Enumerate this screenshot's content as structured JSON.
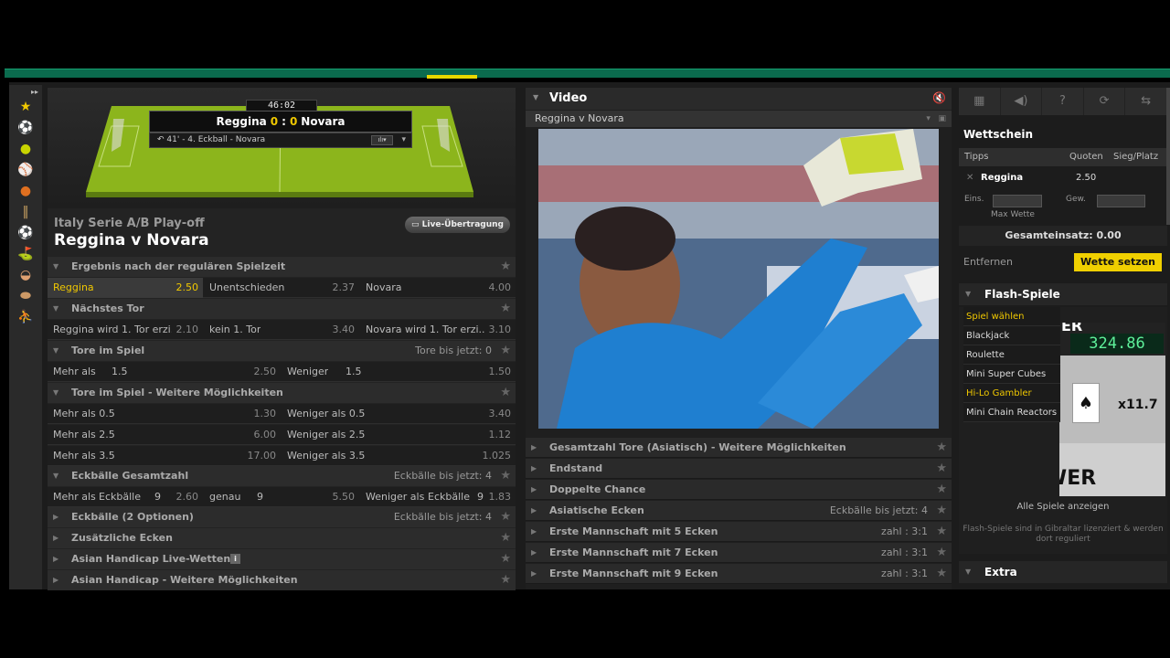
{
  "scoreboard": {
    "time": "46:02",
    "home": "Reggina",
    "home_score": "0",
    "sep": ":",
    "away_score": "0",
    "away": "Novara",
    "event": "41' - 4. Eckball - Novara"
  },
  "match": {
    "league": "Italy Serie A/B Play-off",
    "title": "Reggina v Novara",
    "live_button": "Live-Übertragung"
  },
  "markets": {
    "result": {
      "header": "Ergebnis nach der regulären Spielzeit",
      "home": "Reggina",
      "home_odds": "2.50",
      "draw": "Unentschieden",
      "draw_odds": "2.37",
      "away": "Novara",
      "away_odds": "4.00"
    },
    "next_goal": {
      "header": "Nächstes Tor",
      "a": "Reggina wird 1. Tor erzi...",
      "a_odds": "2.10",
      "b": "kein 1. Tor",
      "b_odds": "3.40",
      "c": "Novara wird 1. Tor erzi...",
      "c_odds": "3.10"
    },
    "goals": {
      "header": "Tore im Spiel",
      "note": "Tore bis jetzt: 0",
      "over": "Mehr als",
      "over_line": "1.5",
      "over_odds": "2.50",
      "under": "Weniger",
      "under_line": "1.5",
      "under_odds": "1.50"
    },
    "goals_more": {
      "header": "Tore im Spiel - Weitere Möglichkeiten",
      "rows": [
        {
          "over": "Mehr als 0.5",
          "over_odds": "1.30",
          "under": "Weniger als 0.5",
          "under_odds": "3.40"
        },
        {
          "over": "Mehr als 2.5",
          "over_odds": "6.00",
          "under": "Weniger als 2.5",
          "under_odds": "1.12"
        },
        {
          "over": "Mehr als 3.5",
          "over_odds": "17.00",
          "under": "Weniger als 3.5",
          "under_odds": "1.025"
        }
      ]
    },
    "corners": {
      "header": "Eckbälle Gesamtzahl",
      "note": "Eckbälle bis jetzt: 4",
      "a": "Mehr als",
      "a_unit": "Eckbälle",
      "a_line": "9",
      "a_odds": "2.60",
      "b": "genau",
      "b_line": "9",
      "b_odds": "5.50",
      "c": "Weniger als",
      "c_unit": "Eckbälle",
      "c_line": "9",
      "c_odds": "1.83"
    },
    "collapsed": [
      {
        "label": "Eckbälle (2 Optionen)",
        "note": "Eckbälle bis jetzt: 4"
      },
      {
        "label": "Zusätzliche Ecken",
        "note": ""
      },
      {
        "label": "Asian Handicap Live-Wetten",
        "note": ""
      },
      {
        "label": "Asian Handicap - Weitere Möglichkeiten",
        "note": ""
      }
    ]
  },
  "video": {
    "title": "Video",
    "subtitle": "Reggina v Novara",
    "markets": [
      {
        "label": "Gesamtzahl Tore (Asiatisch) - Weitere Möglichkeiten",
        "note": ""
      },
      {
        "label": "Endstand",
        "note": ""
      },
      {
        "label": "Doppelte Chance",
        "note": ""
      },
      {
        "label": "Asiatische Ecken",
        "note": "Eckbälle bis jetzt: 4"
      },
      {
        "label": "Erste Mannschaft mit 5 Ecken",
        "note": "zahl : 3:1"
      },
      {
        "label": "Erste Mannschaft mit 7 Ecken",
        "note": "zahl : 3:1"
      },
      {
        "label": "Erste Mannschaft mit 9 Ecken",
        "note": "zahl : 3:1"
      }
    ]
  },
  "betslip": {
    "title": "Wettschein",
    "col_tips": "Tipps",
    "col_odds": "Quoten",
    "col_ew": "Sieg/Platz",
    "selection": "Reggina",
    "selection_odds": "2.50",
    "stake_label": "Eins.",
    "win_label": "Gew.",
    "max_bet": "Max Wette",
    "total": "Gesamteinsatz: 0.00",
    "remove": "Entfernen",
    "place": "Wette setzen"
  },
  "flash": {
    "title": "Flash-Spiele",
    "menu": [
      "Spiel wählen",
      "Blackjack",
      "Roulette",
      "Mini Super Cubes",
      "Hi-Lo Gambler",
      "Mini Chain Reactors"
    ],
    "promo_counter": "324.86",
    "promo_multiplier": "x11.7",
    "promo_lower": "LOWER",
    "promo_er": "ER",
    "show_all": "Alle Spiele anzeigen",
    "note": "Flash-Spiele sind in Gibraltar lizenziert & werden dort reguliert"
  },
  "extra": {
    "title": "Extra"
  },
  "colors": {
    "accent": "#f0c800",
    "brand_green": "#0b6b4e",
    "pitch": "#8cb51c"
  }
}
